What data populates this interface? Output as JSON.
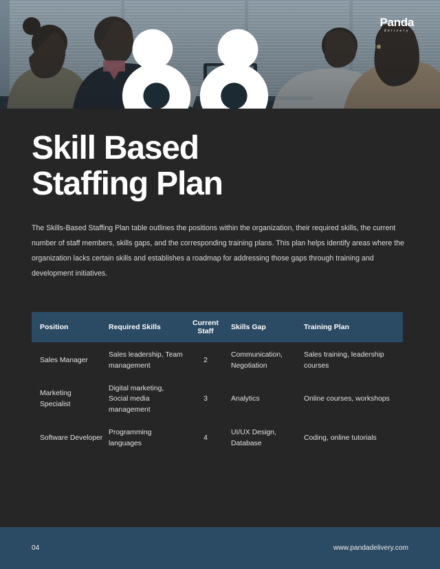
{
  "hero": {
    "alt": "business team in a meeting room with laptop video call",
    "logo": {
      "word": "Panda",
      "sub": "delivery",
      "icon": "panda-face-icon"
    }
  },
  "document": {
    "title_line1": "Skill Based",
    "title_line2": "Staffing Plan",
    "intro": "The Skills-Based Staffing Plan table outlines the positions within the organization, their required skills, the current number of staff members, skills gaps, and the corresponding training plans. This plan helps identify areas where the organization lacks certain skills and establishes a roadmap for addressing those gaps through training and development initiatives."
  },
  "table": {
    "headers": {
      "position": "Position",
      "required_skills": "Required Skills",
      "current_staff_line1": "Current",
      "current_staff_line2": "Staff",
      "skills_gap": "Skills Gap",
      "training_plan": "Training Plan"
    },
    "rows": [
      {
        "position": "Sales Manager",
        "required_skills": "Sales leadership, Team management",
        "current_staff": "2",
        "skills_gap": "Communication, Negotiation",
        "training_plan": "Sales training, leadership courses"
      },
      {
        "position": "Marketing Specialist",
        "required_skills": "Digital marketing, Social media management",
        "current_staff": "3",
        "skills_gap": "Analytics",
        "training_plan": "Online courses, workshops"
      },
      {
        "position": "Software Developer",
        "required_skills": "Programming languages",
        "current_staff": "4",
        "skills_gap": "UI/UX Design, Database",
        "training_plan": "Coding, online tutorials"
      }
    ]
  },
  "footer": {
    "page_number": "04",
    "website": "www.pandadelivery.com"
  },
  "colors": {
    "background": "#262626",
    "accent": "#2b4a63",
    "text": "#e8e8e8",
    "heading": "#ffffff"
  }
}
